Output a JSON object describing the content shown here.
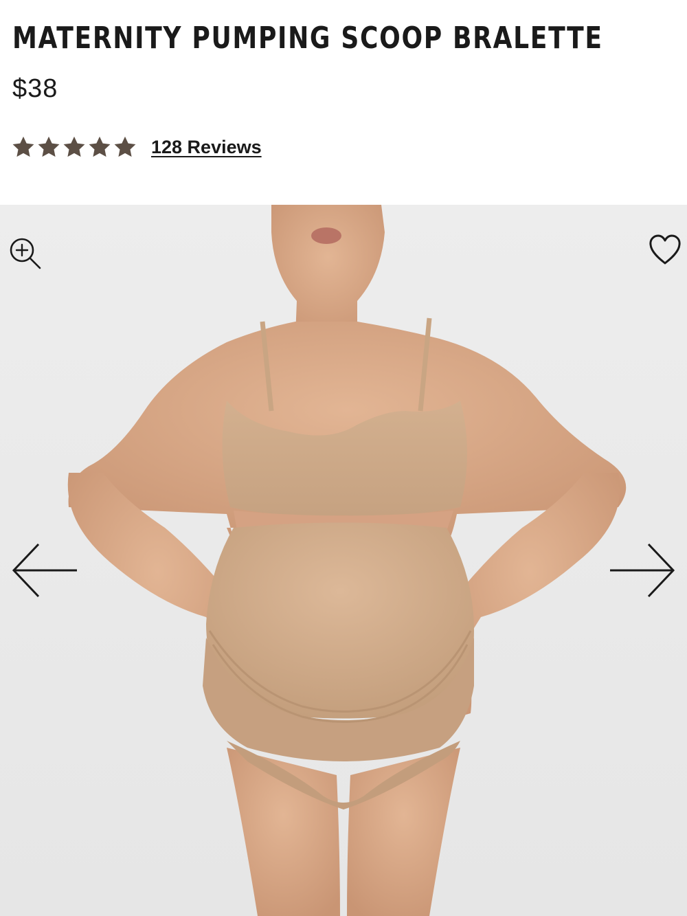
{
  "product": {
    "title": "MATERNITY PUMPING SCOOP BRALETTE",
    "price": "$38",
    "rating": {
      "value": 5,
      "max": 5,
      "star_color": "#5c4f45",
      "reviews_label": "128 Reviews"
    }
  },
  "gallery": {
    "background_color": "#ececec",
    "garment_color": "#cfa987",
    "skin_color": "#d9ab8a",
    "icons": {
      "zoom": "zoom-in-icon",
      "favorite": "heart-icon",
      "previous": "arrow-left-icon",
      "next": "arrow-right-icon"
    }
  }
}
